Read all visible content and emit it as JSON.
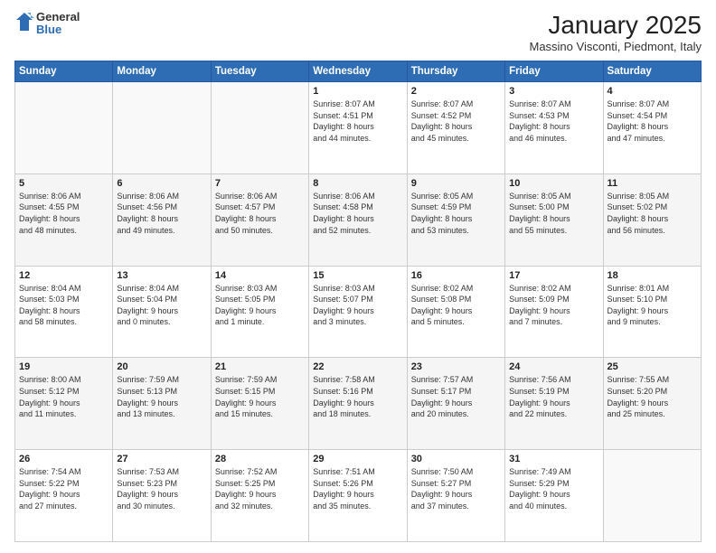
{
  "logo": {
    "general": "General",
    "blue": "Blue"
  },
  "header": {
    "title": "January 2025",
    "location": "Massino Visconti, Piedmont, Italy"
  },
  "weekdays": [
    "Sunday",
    "Monday",
    "Tuesday",
    "Wednesday",
    "Thursday",
    "Friday",
    "Saturday"
  ],
  "weeks": [
    [
      {
        "day": "",
        "info": ""
      },
      {
        "day": "",
        "info": ""
      },
      {
        "day": "",
        "info": ""
      },
      {
        "day": "1",
        "info": "Sunrise: 8:07 AM\nSunset: 4:51 PM\nDaylight: 8 hours\nand 44 minutes."
      },
      {
        "day": "2",
        "info": "Sunrise: 8:07 AM\nSunset: 4:52 PM\nDaylight: 8 hours\nand 45 minutes."
      },
      {
        "day": "3",
        "info": "Sunrise: 8:07 AM\nSunset: 4:53 PM\nDaylight: 8 hours\nand 46 minutes."
      },
      {
        "day": "4",
        "info": "Sunrise: 8:07 AM\nSunset: 4:54 PM\nDaylight: 8 hours\nand 47 minutes."
      }
    ],
    [
      {
        "day": "5",
        "info": "Sunrise: 8:06 AM\nSunset: 4:55 PM\nDaylight: 8 hours\nand 48 minutes."
      },
      {
        "day": "6",
        "info": "Sunrise: 8:06 AM\nSunset: 4:56 PM\nDaylight: 8 hours\nand 49 minutes."
      },
      {
        "day": "7",
        "info": "Sunrise: 8:06 AM\nSunset: 4:57 PM\nDaylight: 8 hours\nand 50 minutes."
      },
      {
        "day": "8",
        "info": "Sunrise: 8:06 AM\nSunset: 4:58 PM\nDaylight: 8 hours\nand 52 minutes."
      },
      {
        "day": "9",
        "info": "Sunrise: 8:05 AM\nSunset: 4:59 PM\nDaylight: 8 hours\nand 53 minutes."
      },
      {
        "day": "10",
        "info": "Sunrise: 8:05 AM\nSunset: 5:00 PM\nDaylight: 8 hours\nand 55 minutes."
      },
      {
        "day": "11",
        "info": "Sunrise: 8:05 AM\nSunset: 5:02 PM\nDaylight: 8 hours\nand 56 minutes."
      }
    ],
    [
      {
        "day": "12",
        "info": "Sunrise: 8:04 AM\nSunset: 5:03 PM\nDaylight: 8 hours\nand 58 minutes."
      },
      {
        "day": "13",
        "info": "Sunrise: 8:04 AM\nSunset: 5:04 PM\nDaylight: 9 hours\nand 0 minutes."
      },
      {
        "day": "14",
        "info": "Sunrise: 8:03 AM\nSunset: 5:05 PM\nDaylight: 9 hours\nand 1 minute."
      },
      {
        "day": "15",
        "info": "Sunrise: 8:03 AM\nSunset: 5:07 PM\nDaylight: 9 hours\nand 3 minutes."
      },
      {
        "day": "16",
        "info": "Sunrise: 8:02 AM\nSunset: 5:08 PM\nDaylight: 9 hours\nand 5 minutes."
      },
      {
        "day": "17",
        "info": "Sunrise: 8:02 AM\nSunset: 5:09 PM\nDaylight: 9 hours\nand 7 minutes."
      },
      {
        "day": "18",
        "info": "Sunrise: 8:01 AM\nSunset: 5:10 PM\nDaylight: 9 hours\nand 9 minutes."
      }
    ],
    [
      {
        "day": "19",
        "info": "Sunrise: 8:00 AM\nSunset: 5:12 PM\nDaylight: 9 hours\nand 11 minutes."
      },
      {
        "day": "20",
        "info": "Sunrise: 7:59 AM\nSunset: 5:13 PM\nDaylight: 9 hours\nand 13 minutes."
      },
      {
        "day": "21",
        "info": "Sunrise: 7:59 AM\nSunset: 5:15 PM\nDaylight: 9 hours\nand 15 minutes."
      },
      {
        "day": "22",
        "info": "Sunrise: 7:58 AM\nSunset: 5:16 PM\nDaylight: 9 hours\nand 18 minutes."
      },
      {
        "day": "23",
        "info": "Sunrise: 7:57 AM\nSunset: 5:17 PM\nDaylight: 9 hours\nand 20 minutes."
      },
      {
        "day": "24",
        "info": "Sunrise: 7:56 AM\nSunset: 5:19 PM\nDaylight: 9 hours\nand 22 minutes."
      },
      {
        "day": "25",
        "info": "Sunrise: 7:55 AM\nSunset: 5:20 PM\nDaylight: 9 hours\nand 25 minutes."
      }
    ],
    [
      {
        "day": "26",
        "info": "Sunrise: 7:54 AM\nSunset: 5:22 PM\nDaylight: 9 hours\nand 27 minutes."
      },
      {
        "day": "27",
        "info": "Sunrise: 7:53 AM\nSunset: 5:23 PM\nDaylight: 9 hours\nand 30 minutes."
      },
      {
        "day": "28",
        "info": "Sunrise: 7:52 AM\nSunset: 5:25 PM\nDaylight: 9 hours\nand 32 minutes."
      },
      {
        "day": "29",
        "info": "Sunrise: 7:51 AM\nSunset: 5:26 PM\nDaylight: 9 hours\nand 35 minutes."
      },
      {
        "day": "30",
        "info": "Sunrise: 7:50 AM\nSunset: 5:27 PM\nDaylight: 9 hours\nand 37 minutes."
      },
      {
        "day": "31",
        "info": "Sunrise: 7:49 AM\nSunset: 5:29 PM\nDaylight: 9 hours\nand 40 minutes."
      },
      {
        "day": "",
        "info": ""
      }
    ]
  ]
}
